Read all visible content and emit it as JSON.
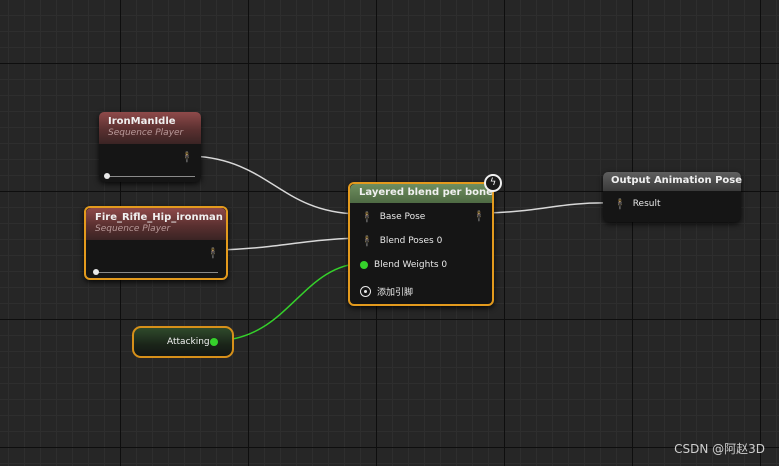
{
  "nodes": {
    "iron_man_idle": {
      "title": "IronManIdle",
      "subtitle": "Sequence Player"
    },
    "fire_rifle": {
      "title": "Fire_Rifle_Hip_ironman",
      "subtitle": "Sequence Player"
    },
    "layered_blend": {
      "title": "Layered blend per bone",
      "pins": {
        "base_pose": "Base Pose",
        "blend_poses": "Blend Poses 0",
        "blend_weights": "Blend Weights 0",
        "add_pin": "添加引脚"
      }
    },
    "output_pose": {
      "title": "Output Animation Pose",
      "pins": {
        "result": "Result"
      }
    },
    "attacking": {
      "label": "Attacking"
    }
  },
  "watermark": "CSDN @阿赵3D",
  "colors": {
    "selection_outline": "#e39a1d",
    "pose_wire": "#d8d8d8",
    "float_wire": "#35d12b",
    "sequence_header": "#8e4a4a",
    "blend_header": "#6f8e5f",
    "output_header": "#5f5f5f"
  }
}
